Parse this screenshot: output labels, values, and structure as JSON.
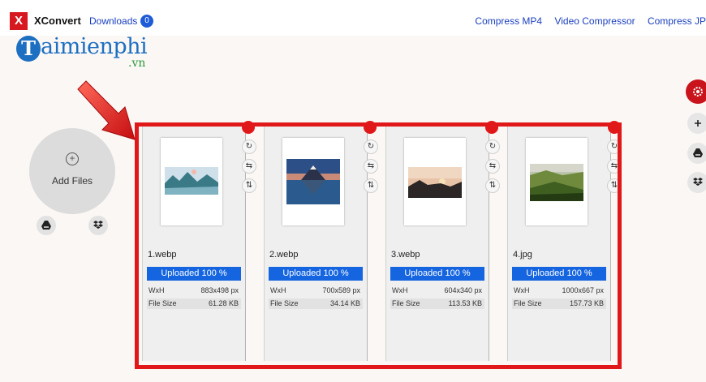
{
  "app": {
    "logo": "X",
    "title": "XConvert",
    "downloads_label": "Downloads",
    "downloads_count": "0"
  },
  "nav": {
    "links": [
      "Compress MP4",
      "Video Compressor",
      "Compress JP"
    ]
  },
  "watermark": {
    "text": "aimienphi",
    "letter": "T",
    "suffix": ".vn"
  },
  "uploader": {
    "add_files_label": "Add Files"
  },
  "files": [
    {
      "name": "1.webp",
      "status": "Uploaded 100 %",
      "wxh_label": "WxH",
      "wxh": "883x498 px",
      "size_label": "File Size",
      "size": "61.28 KB"
    },
    {
      "name": "2.webp",
      "status": "Uploaded 100 %",
      "wxh_label": "WxH",
      "wxh": "700x589 px",
      "size_label": "File Size",
      "size": "34.14 KB"
    },
    {
      "name": "3.webp",
      "status": "Uploaded 100 %",
      "wxh_label": "WxH",
      "wxh": "604x340 px",
      "size_label": "File Size",
      "size": "113.53 KB"
    },
    {
      "name": "4.jpg",
      "status": "Uploaded 100 %",
      "wxh_label": "WxH",
      "wxh": "1000x667 px",
      "size_label": "File Size",
      "size": "157.73 KB"
    }
  ],
  "colors": {
    "brand_red": "#d7181f",
    "link_blue": "#1a3fbf",
    "upload_blue": "#1565e0",
    "highlight_red": "#e0181a"
  },
  "icons": {
    "card_tools": [
      "rotate-icon",
      "flip-horizontal-icon",
      "flip-vertical-icon"
    ],
    "side_buttons": [
      "settings-icon",
      "plus-icon",
      "google-drive-icon",
      "dropbox-icon"
    ]
  }
}
